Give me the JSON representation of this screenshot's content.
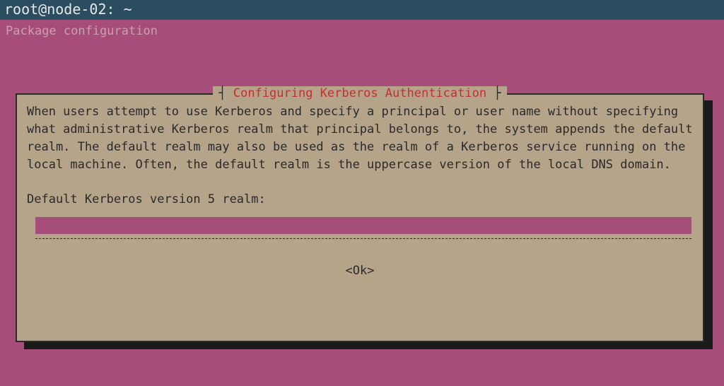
{
  "window": {
    "title": "root@node-02: ~"
  },
  "header": {
    "text": "Package configuration"
  },
  "dialog": {
    "title": "Configuring Kerberos Authentication",
    "description": "When users attempt to use Kerberos and specify a principal or user name without specifying what administrative Kerberos realm that principal belongs to, the system appends the default realm.  The default realm may also be used as the realm of a Kerberos service running on the local machine.  Often, the default realm is the uppercase version of the local DNS domain.",
    "prompt": "Default Kerberos version 5 realm:",
    "input_value": "",
    "ok_label": "<Ok>"
  }
}
